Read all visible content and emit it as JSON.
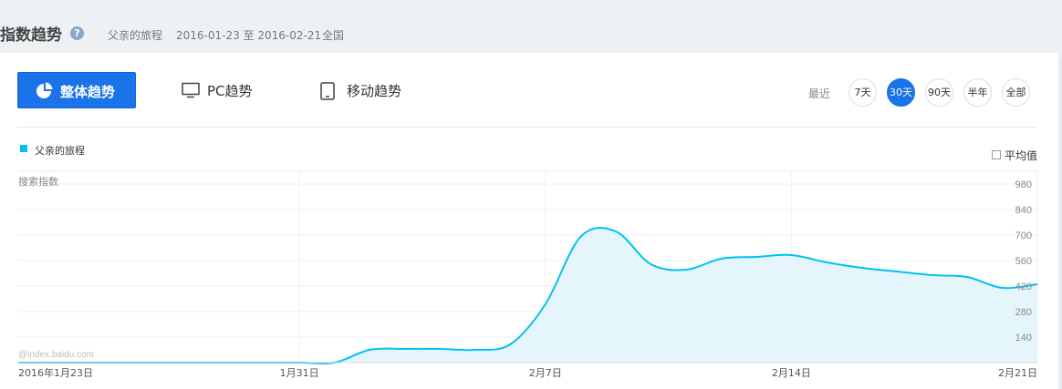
{
  "header": {
    "title": "指数趋势",
    "help_icon": "help-circle-icon",
    "keyword": "父亲的旅程",
    "date_range": "2016-01-23 至 2016-02-21",
    "region": "全国"
  },
  "tabs": [
    {
      "label": "整体趋势",
      "icon": "pie-chart-icon",
      "active": true
    },
    {
      "label": "PC趋势",
      "icon": "monitor-icon",
      "active": false
    },
    {
      "label": "移动趋势",
      "icon": "tablet-icon",
      "active": false
    }
  ],
  "range": {
    "label": "最近",
    "options": [
      "7天",
      "30天",
      "90天",
      "半年",
      "全部"
    ],
    "selected": "30天"
  },
  "average_toggle": {
    "label": "平均值",
    "checked": false
  },
  "watermark": "@index.baidu.com",
  "colors": {
    "accent": "#1a73e8",
    "series_line": "#00c1ef",
    "series_fill": "#e4f6fc"
  },
  "chart_data": {
    "type": "area",
    "ylabel": "搜索指数",
    "ylim": [
      0,
      1050
    ],
    "yticks": [
      140,
      280,
      420,
      560,
      700,
      840,
      980
    ],
    "x_tick_labels": [
      {
        "index": 0,
        "label": "2016年1月23日"
      },
      {
        "index": 8,
        "label": "1月31日"
      },
      {
        "index": 15,
        "label": "2月7日"
      },
      {
        "index": 22,
        "label": "2月14日"
      },
      {
        "index": 29,
        "label": "2月21日"
      }
    ],
    "series": [
      {
        "name": "父亲的旅程",
        "x": [
          "2016-01-23",
          "2016-01-24",
          "2016-01-25",
          "2016-01-26",
          "2016-01-27",
          "2016-01-28",
          "2016-01-29",
          "2016-01-30",
          "2016-01-31",
          "2016-02-01",
          "2016-02-02",
          "2016-02-03",
          "2016-02-04",
          "2016-02-05",
          "2016-02-06",
          "2016-02-07",
          "2016-02-08",
          "2016-02-09",
          "2016-02-10",
          "2016-02-11",
          "2016-02-12",
          "2016-02-13",
          "2016-02-14",
          "2016-02-15",
          "2016-02-16",
          "2016-02-17",
          "2016-02-18",
          "2016-02-19",
          "2016-02-20",
          "2016-02-21"
        ],
        "values": [
          0,
          0,
          0,
          0,
          0,
          0,
          0,
          0,
          0,
          0,
          70,
          75,
          75,
          70,
          100,
          320,
          690,
          720,
          540,
          510,
          570,
          580,
          590,
          550,
          520,
          500,
          480,
          470,
          410,
          430
        ]
      }
    ]
  }
}
